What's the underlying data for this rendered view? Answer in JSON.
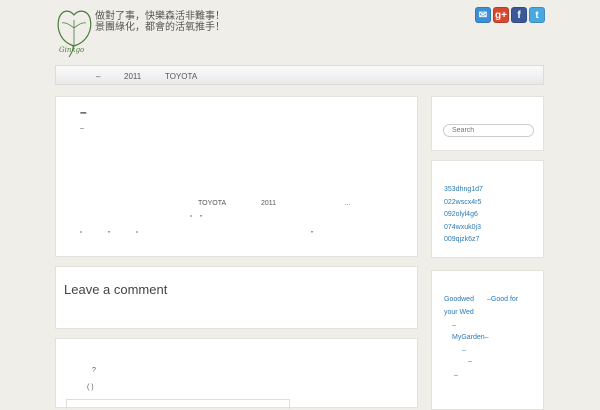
{
  "header": {
    "logo_text": "Ginkgo",
    "tagline": [
      "做對了事，快樂森活非難事！",
      "景團綠化，都會的活氧推手！"
    ]
  },
  "social": [
    {
      "name": "email-icon",
      "glyph": "✉",
      "color": "#3d8fd6"
    },
    {
      "name": "google-plus-icon",
      "glyph": "g+",
      "color": "#d6492f"
    },
    {
      "name": "facebook-icon",
      "glyph": "f",
      "color": "#3b5998"
    },
    {
      "name": "twitter-icon",
      "glyph": "t",
      "color": "#4aa8e0"
    }
  ],
  "nav": {
    "dash": "–",
    "year": "2011",
    "brand": "TOYOTA"
  },
  "post": {
    "title": "–",
    "meta": "–",
    "line1_a": "TOYOTA",
    "line1_b": "2011",
    "line1_c": "…",
    "line2_a": "“",
    "line2_b": "”",
    "line3_a": "“",
    "line3_b": "”",
    "line3_c": "“",
    "line3_d": "”"
  },
  "comment": {
    "heading": "Leave a comment"
  },
  "form": {
    "q": "?",
    "paren": "(     )"
  },
  "sidebar": {
    "search_placeholder": "Search",
    "links": [
      "353dhng1d7",
      "022wscx4r5",
      "092olyl4g6",
      "074wxuk0j3",
      "009qjzk6z7"
    ],
    "blogroll": {
      "goodwed": "Goodwed",
      "good_for": "–Good for",
      "your_wed": "your Wed",
      "dash1": "–",
      "mygarden": "MyGarden–",
      "dash2": "–",
      "dash3": "–",
      "dash4": "–"
    }
  }
}
